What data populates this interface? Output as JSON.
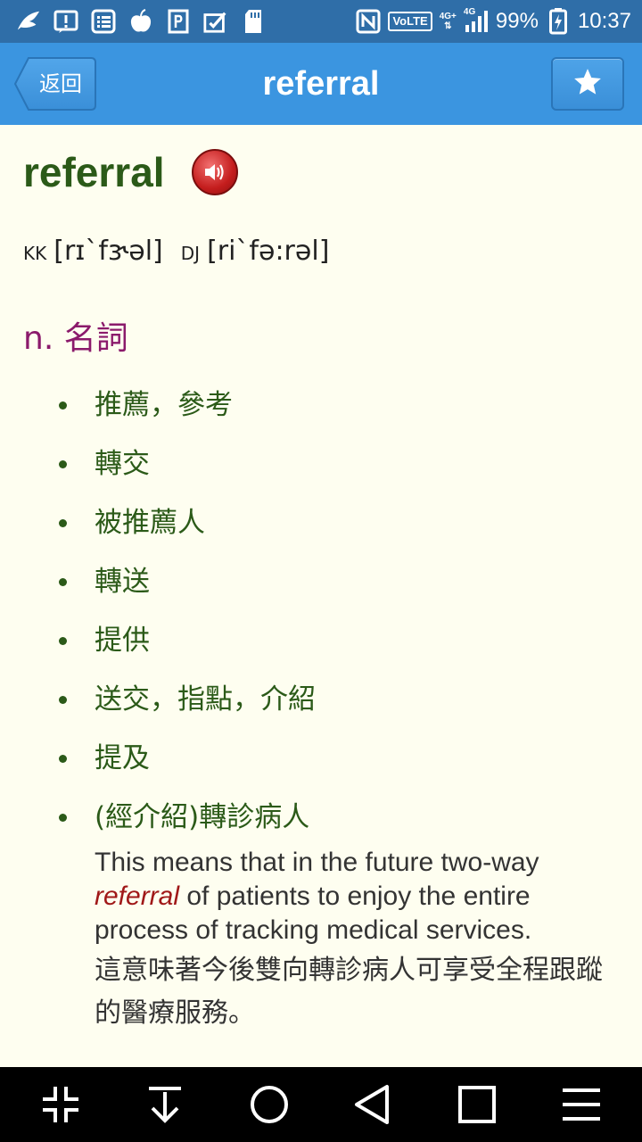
{
  "status_bar": {
    "battery": "99%",
    "time": "10:37",
    "network_badge": "VoLTE",
    "network_4g_plus": "4G+",
    "network_4g": "4G",
    "icons": [
      "wing-icon",
      "alert-icon",
      "list-icon",
      "apple-icon",
      "parking-icon",
      "clipboard-check-icon",
      "sd-card-icon",
      "nfc-icon",
      "signal-icon",
      "battery-charging-icon"
    ]
  },
  "app_bar": {
    "back_label": "返回",
    "title": "referral",
    "favorite_icon": "star-icon"
  },
  "entry": {
    "headword": "referral",
    "speaker_icon": "speaker-icon",
    "pronunciation": {
      "kk_tag": "KK",
      "kk_value": "[rɪ`fɝəl]",
      "dj_tag": "DJ",
      "dj_value": "[ri`fə:rəl]"
    },
    "part_of_speech": "n. 名詞",
    "senses": [
      "推薦，參考",
      "轉交",
      "被推薦人",
      "轉送",
      "提供",
      "送交，指點，介紹",
      "提及",
      "(經介紹)轉診病人"
    ],
    "example": {
      "en_before": "This means that in the future two-way ",
      "en_keyword": "referral",
      "en_after": " of patients to enjoy the entire process of tracking medical services.",
      "zh": "這意味著今後雙向轉診病人可享受全程跟蹤的醫療服務。"
    }
  },
  "colors": {
    "status_bar": "#2f6ea8",
    "app_bar": "#3b95e0",
    "background": "#fefef0",
    "headword": "#2b5a18",
    "part_of_speech": "#8b1a6b",
    "keyword": "#a01818"
  },
  "nav_bar": {
    "icons": [
      "collapse-icon",
      "download-icon",
      "home-icon",
      "back-icon",
      "recents-icon",
      "menu-icon"
    ]
  }
}
